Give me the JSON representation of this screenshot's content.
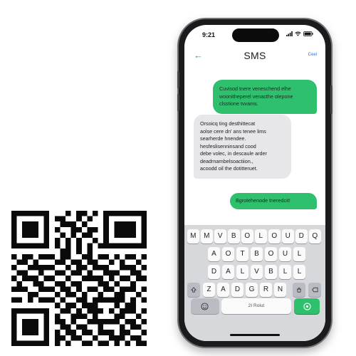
{
  "qr": {
    "size": 25,
    "matrix": [
      "1111111000101101011111111",
      "1000001011001010010000001",
      "1011101001110100010111101",
      "1011101010011011010111101",
      "1011101001010110010111101",
      "1000001010101001010000001",
      "1111111010101010111111111",
      "0000000001101010000000000",
      "1011011101100110110101101",
      "0110100011011011001010010",
      "1001111100101101110011101",
      "0110010011011010011100110",
      "1011101100100111101011011",
      "0100110011011000110100100",
      "1110011101101011011011101",
      "0001100010110100100110010",
      "1101011101001101111110101",
      "0000000010110111000101100",
      "1111111001101011101011101",
      "1000001010011101000110010",
      "1011101011010011111101101",
      "1011101001101100100010110",
      "1011101010110110111011001",
      "1000001011011001001110110",
      "1111111010100110110101011"
    ]
  },
  "phone": {
    "status": {
      "time": "9:21"
    },
    "nav": {
      "back_icon": "back-arrow-icon",
      "title": "SMS",
      "action": "Ceel"
    },
    "messages": [
      {
        "direction": "out",
        "lines": [
          "Cuvisod tnere veneschend elhe",
          "woonitheperel venacthe olepone",
          "clsstione tvvams."
        ]
      },
      {
        "direction": "in",
        "lines": [
          "Orsoicq ting desthittecat",
          "aolse cere dn' ans tenee lims",
          "searherde hnendee.",
          "hesfeslisenninsand cood",
          "debe volec, in descaule arder",
          "deadrnarnbelsoactiion.,",
          "acoodd oil the dotitteruet."
        ]
      },
      {
        "direction": "out",
        "lines": [
          "Bgrotehenode tneredcit!"
        ]
      }
    ],
    "keyboard": {
      "row1": [
        "M",
        "M",
        "V",
        "B",
        "O",
        "L",
        "O",
        "U",
        "D",
        "Q"
      ],
      "row2": [
        "A",
        "O",
        "T",
        "B",
        "O",
        "U",
        "L"
      ],
      "row3": [
        "D",
        "A",
        "L",
        "V",
        "B",
        "L",
        "L"
      ],
      "row4": [
        "Z",
        "A",
        "D",
        "G",
        "R",
        "N"
      ],
      "space_label": "2I Rolut",
      "colors": {
        "send": "#2fc06d",
        "bubble_out": "#2fc06d",
        "accent": "#22b05c"
      }
    }
  }
}
